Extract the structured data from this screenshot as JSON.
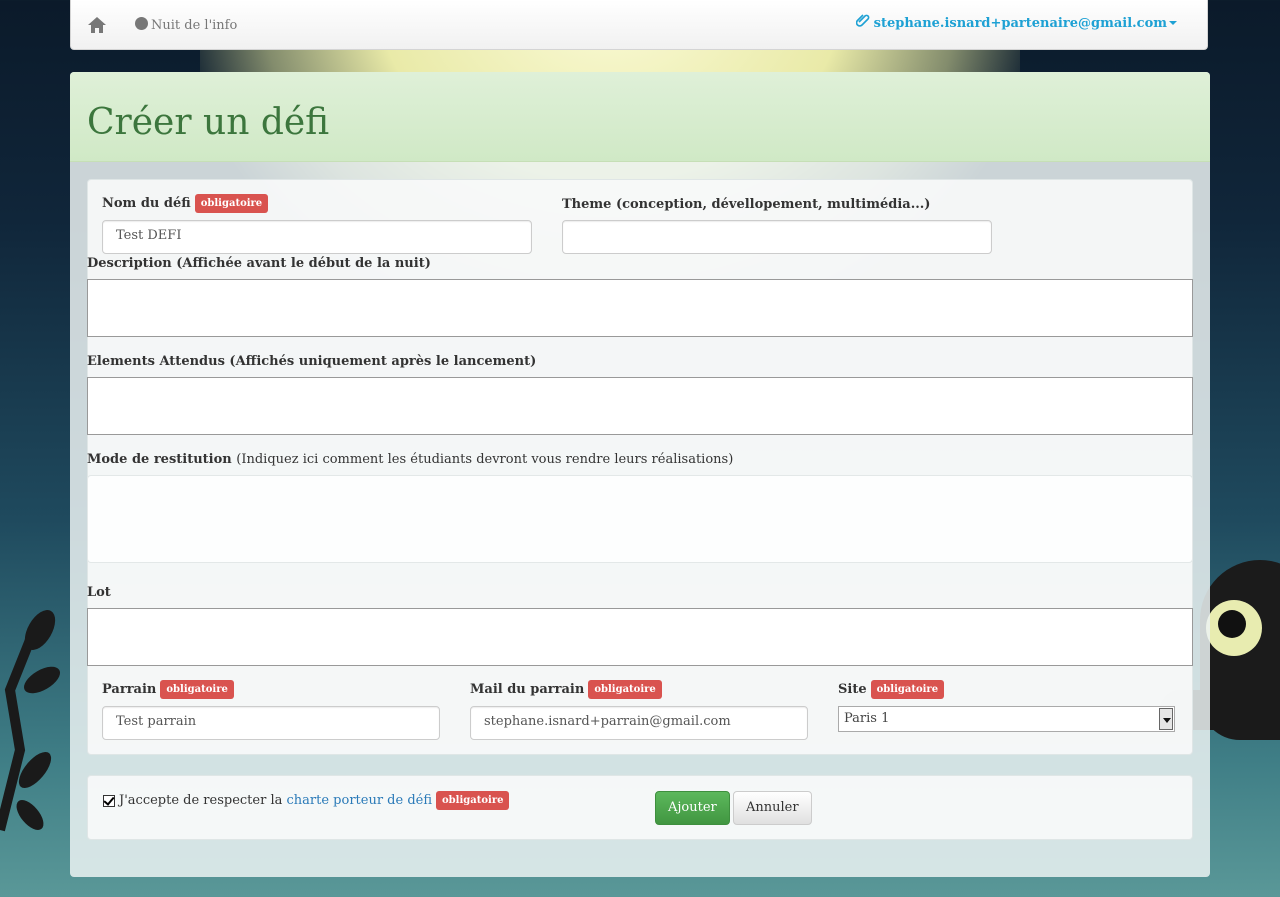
{
  "navbar": {
    "home_icon": "home-icon",
    "brand_label": "Nuit de l'info",
    "brand_icon": "globe-icon",
    "user_email": "stephane.isnard+partenaire@gmail.com",
    "user_icon": "paperclip-icon"
  },
  "page": {
    "title": "Créer un défi"
  },
  "form": {
    "nom_label": "Nom du défi",
    "nom_value": "Test DEFI",
    "theme_label": "Theme (conception, dévellopement, multimédia...)",
    "theme_value": "",
    "description_label": "Description (Affichée avant le début de la nuit)",
    "elements_label": "Elements Attendus (Affichés uniquement après le lancement)",
    "mode_label": "Mode de restitution",
    "mode_hint": "(Indiquez ici comment les étudiants devront vous rendre leurs réalisations)",
    "lot_label": "Lot",
    "parrain_label": "Parrain",
    "parrain_value": "Test parrain",
    "mail_label": "Mail du parrain",
    "mail_value": "stephane.isnard+parrain@gmail.com",
    "site_label": "Site",
    "site_value": "Paris 1",
    "required_badge": "obligatoire"
  },
  "footer": {
    "accept_text": "J'accepte de respecter la",
    "charte_link": "charte porteur de défi",
    "accept_checked": true,
    "submit_label": "Ajouter",
    "cancel_label": "Annuler"
  },
  "colors": {
    "title_green": "#3c763d",
    "badge_red": "#d9534f",
    "link_blue": "#1ea1d4",
    "submit_green": "#5cb85c"
  }
}
